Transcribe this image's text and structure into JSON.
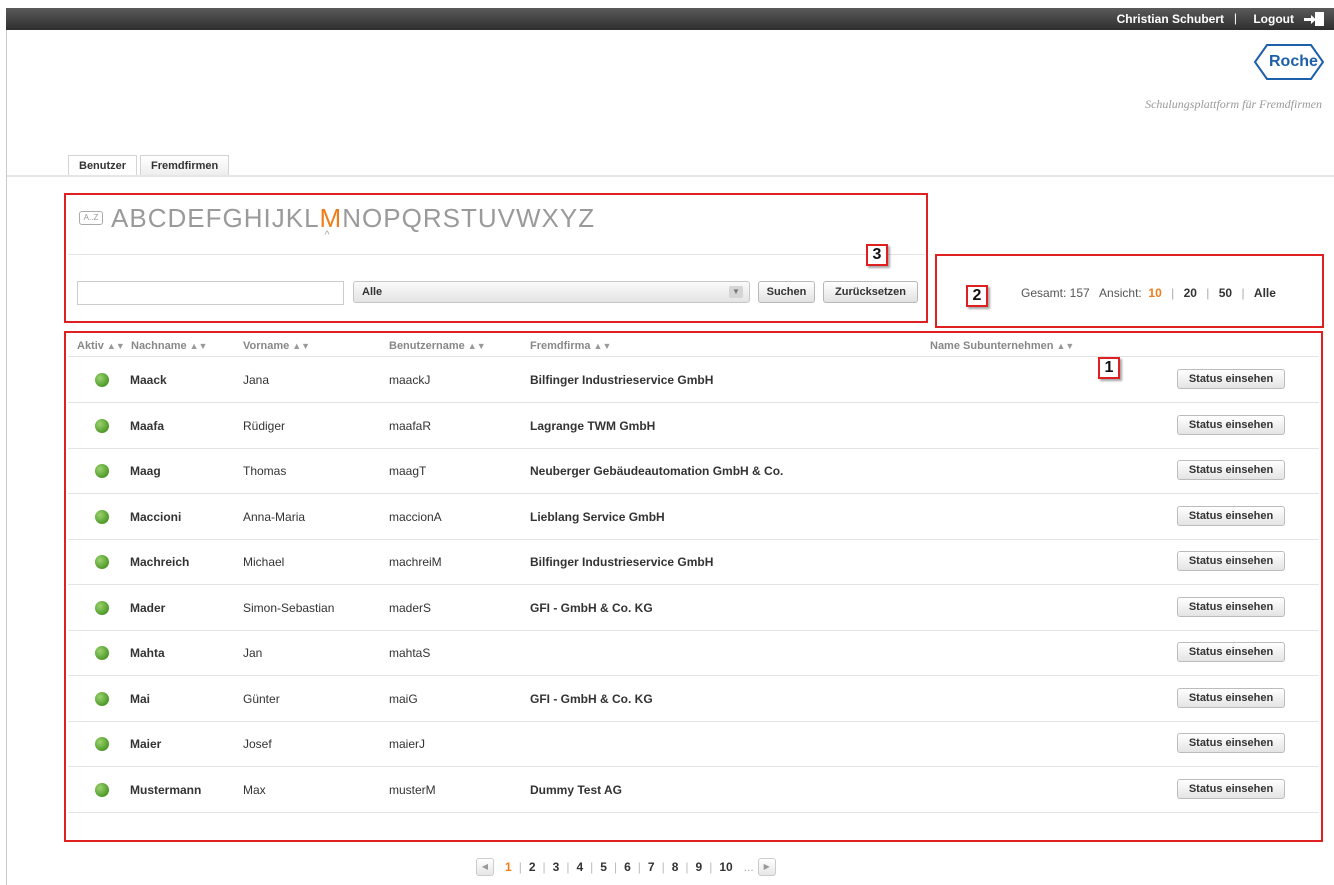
{
  "header": {
    "user_name": "Christian Schubert",
    "separator": "|",
    "logout_label": "Logout"
  },
  "brand": {
    "logo_text": "Roche",
    "tagline": "Schulungsplattform für Fremdfirmen",
    "logo_color": "#1d5fa8"
  },
  "tabs": [
    {
      "label": "Benutzer",
      "active": true
    },
    {
      "label": "Fremdfirmen",
      "active": false
    }
  ],
  "alphabet": {
    "az_icon_label": "A..Z",
    "letters": [
      "A",
      "B",
      "C",
      "D",
      "E",
      "F",
      "G",
      "H",
      "I",
      "J",
      "K",
      "L",
      "M",
      "N",
      "O",
      "P",
      "Q",
      "R",
      "S",
      "T",
      "U",
      "V",
      "W",
      "X",
      "Y",
      "Z"
    ],
    "active_letter": "M"
  },
  "filter": {
    "search_value": "",
    "select_value": "Alle",
    "search_button": "Suchen",
    "reset_button": "Zurücksetzen"
  },
  "summary": {
    "total_label": "Gesamt: 157",
    "view_label": "Ansicht:",
    "view_options": [
      "10",
      "20",
      "50",
      "Alle"
    ],
    "active_view": "10"
  },
  "annotations": [
    "1",
    "2",
    "3"
  ],
  "table": {
    "columns": [
      "Aktiv",
      "Nachname",
      "Vorname",
      "Benutzername",
      "Fremdfirma",
      "Name Subunternehmen"
    ],
    "status_button_label": "Status einsehen",
    "rows": [
      {
        "nachname": "Maack",
        "vorname": "Jana",
        "benutzername": "maackJ",
        "fremdfirma": "Bilfinger Industrieservice GmbH",
        "sub": ""
      },
      {
        "nachname": "Maafa",
        "vorname": "Rüdiger",
        "benutzername": "maafaR",
        "fremdfirma": "Lagrange TWM GmbH",
        "sub": ""
      },
      {
        "nachname": "Maag",
        "vorname": "Thomas",
        "benutzername": "maagT",
        "fremdfirma": "Neuberger Gebäudeautomation GmbH & Co.",
        "sub": ""
      },
      {
        "nachname": "Maccioni",
        "vorname": "Anna-Maria",
        "benutzername": "maccionA",
        "fremdfirma": "Lieblang Service GmbH",
        "sub": ""
      },
      {
        "nachname": "Machreich",
        "vorname": "Michael",
        "benutzername": "machreiM",
        "fremdfirma": "Bilfinger Industrieservice GmbH",
        "sub": ""
      },
      {
        "nachname": "Mader",
        "vorname": "Simon-Sebastian",
        "benutzername": "maderS",
        "fremdfirma": "GFI - GmbH & Co. KG",
        "sub": ""
      },
      {
        "nachname": "Mahta",
        "vorname": "Jan",
        "benutzername": "mahtaS",
        "fremdfirma": "",
        "sub": ""
      },
      {
        "nachname": "Mai",
        "vorname": "Günter",
        "benutzername": "maiG",
        "fremdfirma": "GFI - GmbH & Co. KG",
        "sub": ""
      },
      {
        "nachname": "Maier",
        "vorname": "Josef",
        "benutzername": "maierJ",
        "fremdfirma": "",
        "sub": ""
      },
      {
        "nachname": "Mustermann",
        "vorname": "Max",
        "benutzername": "musterM",
        "fremdfirma": "Dummy Test AG",
        "sub": ""
      }
    ]
  },
  "pagination": {
    "pages": [
      "1",
      "2",
      "3",
      "4",
      "5",
      "6",
      "7",
      "8",
      "9",
      "10"
    ],
    "active_page": "1",
    "ellipsis": "..."
  },
  "colors": {
    "accent": "#ef7d1a",
    "annotation_red": "#e02020",
    "status_active_green": "#4f9a2b"
  }
}
